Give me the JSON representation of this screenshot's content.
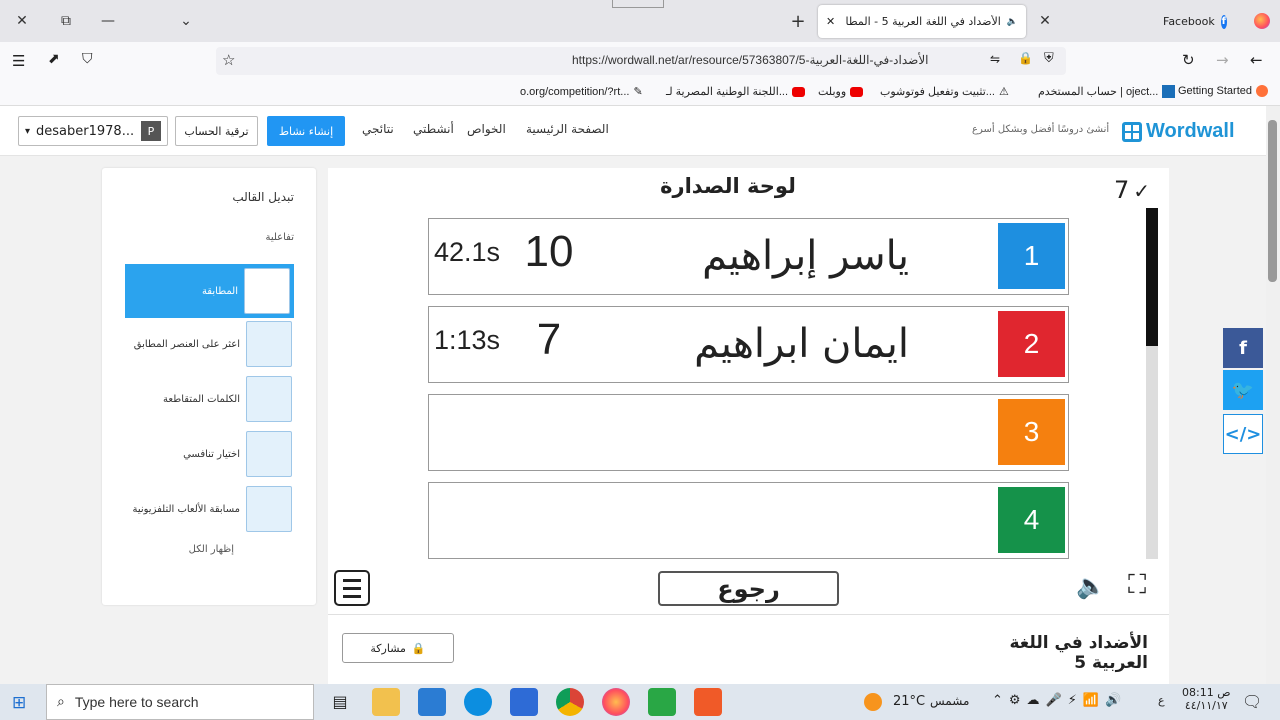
{
  "window": {
    "tab_title": "الأضداد في اللغة العربية 5 - المطا",
    "facebook_tab": "Facebook"
  },
  "navbar": {
    "url": "https://wordwall.net/ar/resource/57363807/5-الأضداد-في-اللغة-العربية"
  },
  "bookmarks": [
    {
      "label": "Getting Started"
    },
    {
      "label": "حساب المستخدم | oject..."
    },
    {
      "label": "تثبيت وتفعيل فوتوشوب..."
    },
    {
      "label": "ووبلت"
    },
    {
      "label": "اللجنة الوطنية المصرية لـ..."
    },
    {
      "label": "o.org/competition/?rt..."
    }
  ],
  "header": {
    "logo": "Wordwall",
    "tagline": "أنشئ دروسًا أفضل وبشكل أسرع",
    "nav": [
      "الصفحة الرئيسية",
      "الخواص",
      "أنشطتي",
      "نتائجي"
    ],
    "create_button": "إنشاء نشاط",
    "upgrade_button": "ترقية الحساب",
    "user": "desaber1978...",
    "user_initial": "P"
  },
  "sidebar": {
    "title": "تبديل القالب",
    "section": "تفاعلية",
    "templates": [
      {
        "label": "المطابقة",
        "active": true
      },
      {
        "label": "اعثر على العنصر المطابق",
        "active": false
      },
      {
        "label": "الكلمات المتقاطعة",
        "active": false
      },
      {
        "label": "اختيار تنافسي",
        "active": false
      },
      {
        "label": "مسابقة الألعاب التلفزيونية",
        "active": false
      }
    ],
    "show_all": "إظهار الكل"
  },
  "leaderboard": {
    "title": "لوحة الصدارة",
    "check_count": "7",
    "rows": [
      {
        "rank": "1",
        "name": "ياسر إبراهيم",
        "score": "10",
        "time": "42.1s",
        "color": "#1e8fe0"
      },
      {
        "rank": "2",
        "name": "ايمان ابراهيم",
        "score": "7",
        "time": "1:13s",
        "color": "#e0262f"
      },
      {
        "rank": "3",
        "name": "",
        "score": "",
        "time": "",
        "color": "#f5800f"
      },
      {
        "rank": "4",
        "name": "",
        "score": "",
        "time": "",
        "color": "#15924a"
      }
    ],
    "back_button": "رجوع"
  },
  "activity": {
    "title": "الأضداد في اللغة العربية 5",
    "share_button": "مشاركة"
  },
  "taskbar": {
    "search_placeholder": "Type here to search",
    "temperature": "21°C",
    "weather": "مشمس",
    "time": "08:11 ص",
    "date": "٤٤/١١/١٧",
    "lang": "ع"
  }
}
